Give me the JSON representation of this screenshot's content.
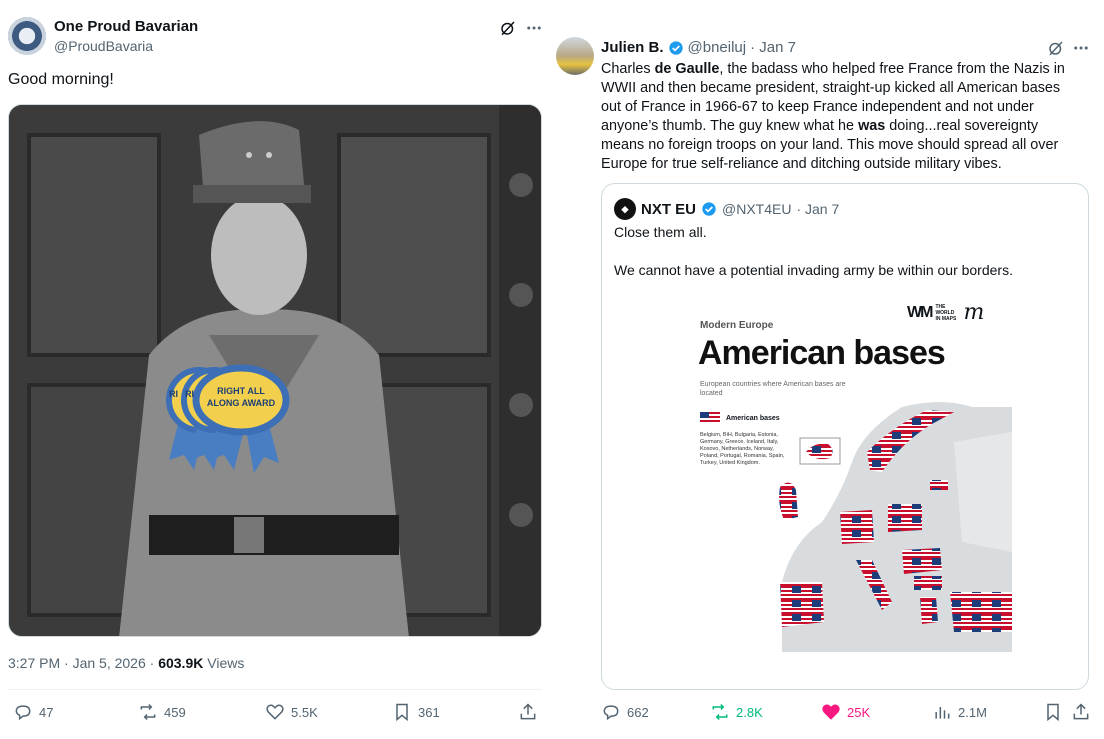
{
  "left_tweet": {
    "name": "One Proud Bavarian",
    "handle": "@ProudBavaria",
    "text": "Good morning!",
    "award_front": "RIGHT ALL ALONG AWARD",
    "award_back1": "RI",
    "award_back2": "RI",
    "meta_time": "3:27 PM · Jan 5, 2026 · ",
    "meta_views": "603.9K",
    "meta_views_label": " Views",
    "actions": {
      "replies": "47",
      "reposts": "459",
      "likes": "5.5K",
      "bookmarks": "361"
    }
  },
  "right_tweet": {
    "name": "Julien B.",
    "handle": "@bneiluj",
    "date": "· Jan 7",
    "text_p1": "Charles ",
    "text_bold1": "de Gaulle",
    "text_p2": ", the badass who helped free France from the Nazis in WWII and then became president, straight-up kicked all American bases out of France in 1966-67 to keep France independent and not under anyone’s thumb. The guy knew what he ",
    "text_bold2": "was",
    "text_p3": " doing...real sovereignty means no foreign troops on your land. This move should spread all over Europe for true self-reliance and ditching outside military vibes.",
    "actions": {
      "replies": "662",
      "reposts": "2.8K",
      "likes": "25K",
      "views": "2.1M"
    },
    "colors": {
      "repost": "#00ba7c",
      "like": "#f91880"
    }
  },
  "quote": {
    "name": "NXT EU",
    "handle": "@NXT4EU",
    "date": "· Jan 7",
    "text1": "Close them all.",
    "text2": "We cannot have a potential invading army be within our borders."
  },
  "map": {
    "kicker": "Modern Europe",
    "title": "American bases",
    "subtitle": "European countries where American bases are located",
    "legend_label": "American bases",
    "country_list": "Belgium, BiH, Bulgaria, Estonia, Germany, Greece, Iceland, Italy, Kosovo, Netherlands, Norway, Poland, Portugal, Romania, Spain, Turkey, United Kingdom.",
    "logo1": "THE WORLD IN MAPS"
  }
}
